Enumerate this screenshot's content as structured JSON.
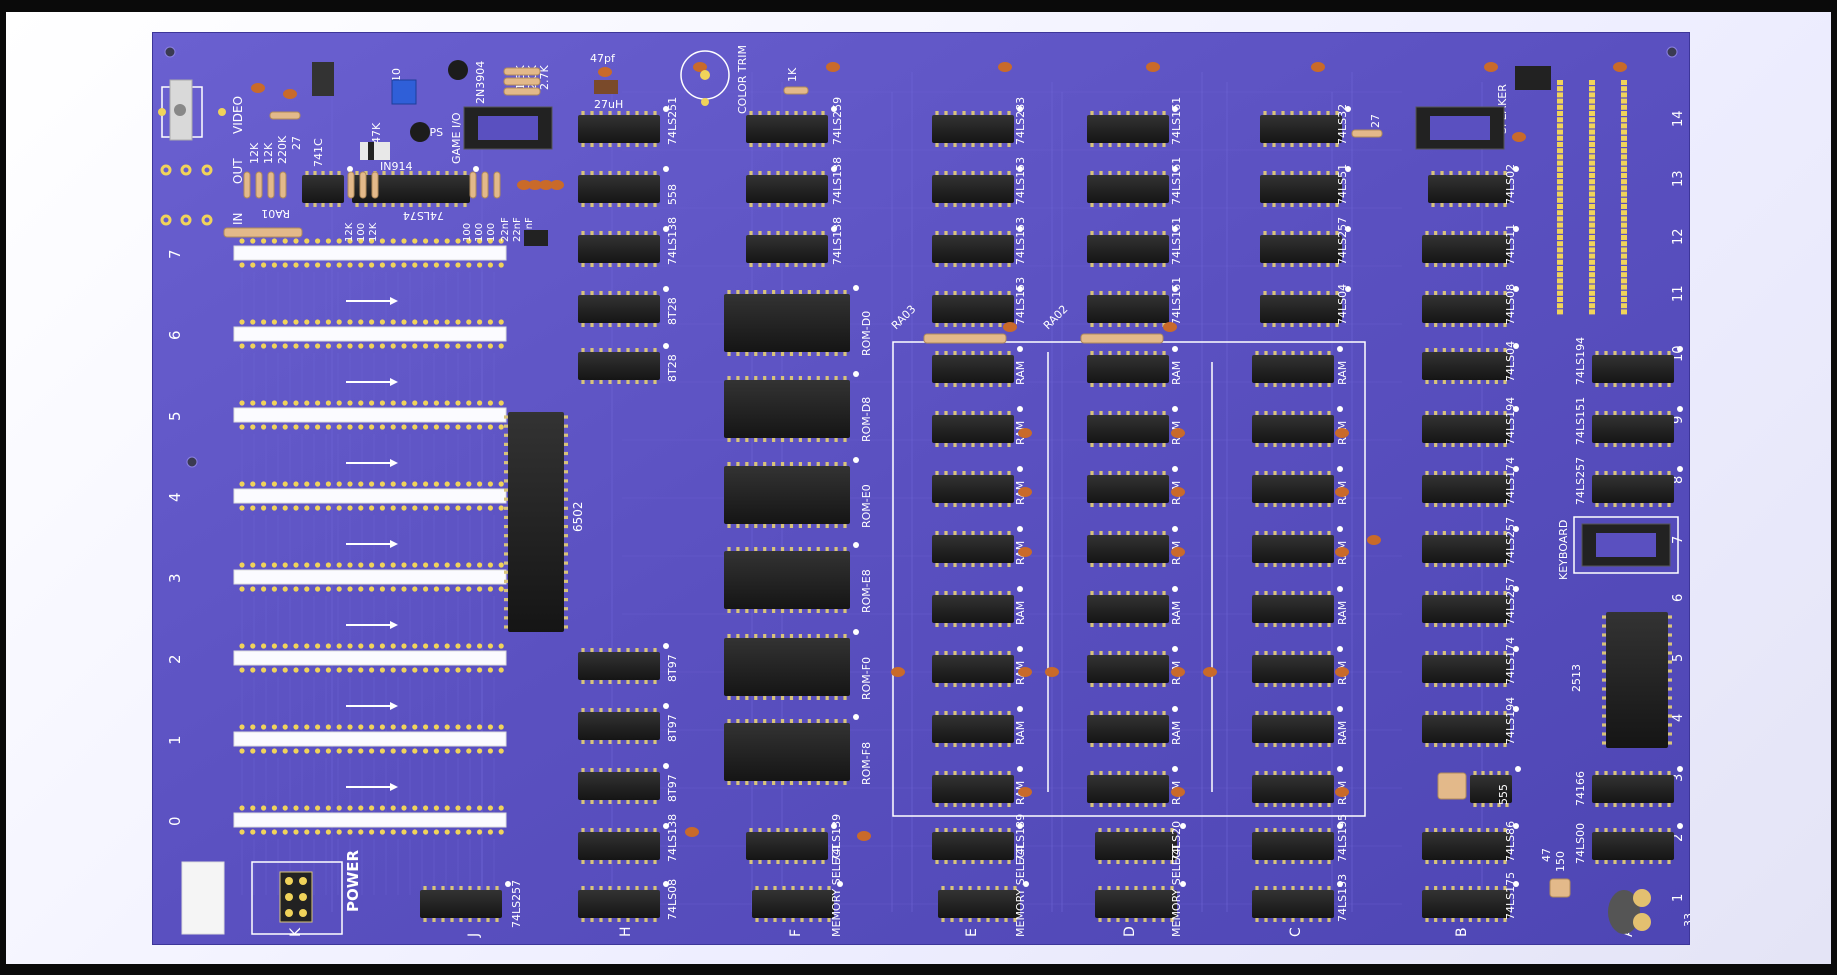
{
  "board": {
    "colors": {
      "pcb": "#5a50c0",
      "pcb_light": "#7a70dd",
      "trace": "#6d63d2",
      "ic_body": "#1e1e1e",
      "pin": "#d8c47a",
      "silk": "#ffffff",
      "resistor": "#e3b98a",
      "capacitor": "#c96a2a",
      "slot": "#fbfbff",
      "pad": "#f0d35a"
    },
    "top_labels": {
      "video": "VIDEO",
      "out": "OUT",
      "in": "IN",
      "r12k_a": "12K",
      "r12k_b": "12K",
      "r220k": "220K",
      "r27": "27",
      "r741c": "741C",
      "r47k": "47K",
      "in914": "IN914",
      "game_io": "GAME I/O",
      "r2n3904": "2N3904",
      "mps": "MPS",
      "r1_5k": "1.5K",
      "r2_0k": "2.0K",
      "r2_7k": "2.7K",
      "r10": "10",
      "r47pf": "47pf",
      "r27uh": "27uH",
      "color_trim": "COLOR TRIM",
      "r1k": "1K",
      "r27b": "27",
      "speaker": "SPEAKER",
      "keyboard": "KEYBOARD",
      "ra01": "RA01",
      "ra02": "RA02",
      "ra03": "RA03",
      "r12k_c": "12K",
      "r100_a": "100",
      "r12k_d": "12K",
      "c74ls74": "74LS74",
      "r100_b": "100",
      "r100_c": "100",
      "r100_d": "100",
      "c22nf_a": "22nF",
      "c22nf_b": "22nF",
      "c22nf_c": "22nF",
      "r47": "47",
      "r150": "150",
      "r33": "33"
    },
    "slot_numbers": [
      "7",
      "6",
      "5",
      "4",
      "3",
      "2",
      "1",
      "0"
    ],
    "row_numbers": [
      "14",
      "13",
      "12",
      "11",
      "10",
      "9",
      "8",
      "7",
      "6",
      "5",
      "4",
      "3",
      "2",
      "1"
    ],
    "column_letters": {
      "K": "K",
      "J": "J",
      "H": "H",
      "F": "F",
      "E": "E",
      "D": "D",
      "C": "C",
      "B": "B",
      "A": "A"
    },
    "power_label": "POWER",
    "memory_select": "MEMORY SELECT",
    "col_H": [
      "74LS251",
      "558",
      "74LS138",
      "8T28",
      "8T28",
      "6502",
      "8T97",
      "8T97",
      "8T97",
      "74LS138",
      "74LS08"
    ],
    "col_F": [
      "74LS259",
      "74LS138",
      "74LS138",
      "ROM-D0",
      "ROM-D8",
      "ROM-E0",
      "ROM-E8",
      "ROM-F0",
      "ROM-F8",
      "74LS139"
    ],
    "col_E": [
      "74LS283",
      "74LS153",
      "74LS153",
      "74LS153",
      "RAM",
      "74LS139"
    ],
    "col_D": [
      "74LS161",
      "74LS161",
      "74LS161",
      "74LS161",
      "RAM",
      "74LS20"
    ],
    "col_C": [
      "74LS32",
      "74LS51",
      "74LS257",
      "74LS04",
      "RAM",
      "74LS195",
      "74LS153"
    ],
    "col_B": [
      "74LS02",
      "74LS11",
      "74LS08",
      "74LS04",
      "74LS194",
      "74LS174",
      "74LS257",
      "74LS257",
      "74LS174",
      "74LS194",
      "555",
      "74LS86",
      "74LS175"
    ],
    "col_A": [
      "74LS194",
      "74LS151",
      "74LS257",
      "2513",
      "74166",
      "74LS00"
    ],
    "j_chip": "74LS257"
  }
}
